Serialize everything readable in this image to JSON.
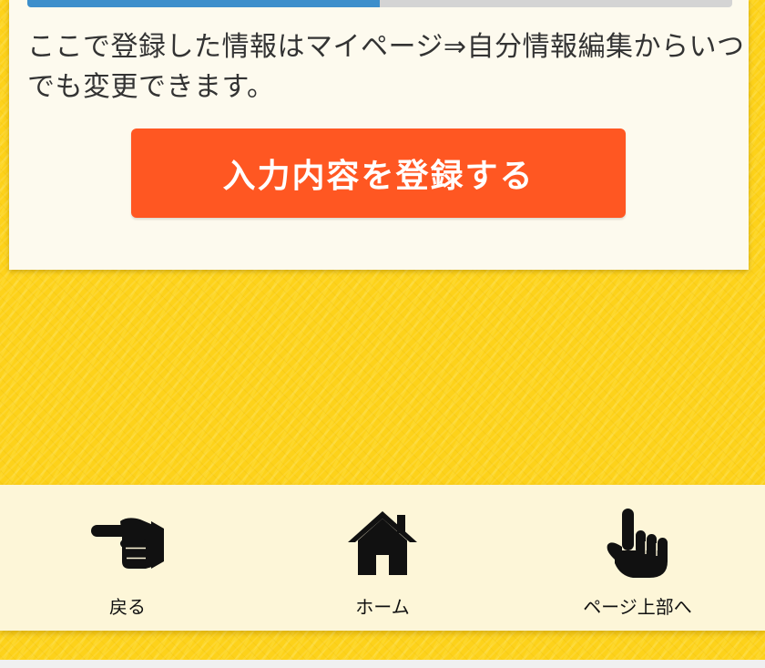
{
  "form": {
    "progress_fraction": 0.5,
    "info_text": "ここで登録した情報はマイページ⇒自分情報編集からいつでも変更できます。",
    "submit_label": "入力内容を登録する"
  },
  "footer_nav": {
    "items": [
      {
        "label": "戻る",
        "icon": "pointing-right-hand-icon"
      },
      {
        "label": "ホーム",
        "icon": "home-icon"
      },
      {
        "label": "ページ上部へ",
        "icon": "pointing-up-hand-icon"
      }
    ]
  },
  "colors": {
    "background": "#fdd21a",
    "card": "#fdfaee",
    "accent_button": "#ff5722",
    "progress_fill": "#3d8fcb",
    "progress_track": "#d4d4d4",
    "footer": "#fdf6d8"
  }
}
